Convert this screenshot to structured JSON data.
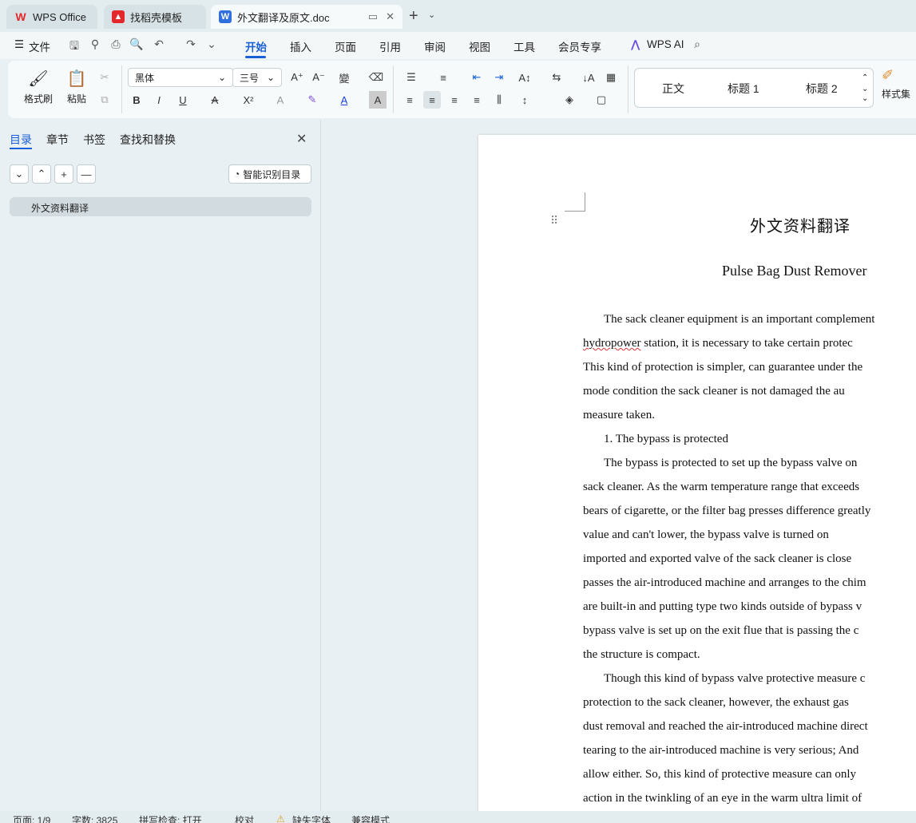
{
  "tabs": [
    {
      "label": "WPS Office",
      "icon": "wps-logo-icon"
    },
    {
      "label": "找稻壳模板",
      "icon": "docer-icon"
    },
    {
      "label": "外文翻译及原文.doc",
      "icon": "word-doc-icon"
    }
  ],
  "menu": {
    "file": "文件",
    "items": [
      "开始",
      "插入",
      "页面",
      "引用",
      "审阅",
      "视图",
      "工具",
      "会员专享"
    ],
    "ai": "WPS AI"
  },
  "ribbon": {
    "format_painter": "格式刷",
    "paste": "粘贴",
    "font_name": "黑体",
    "font_size": "三号",
    "styles": [
      "正文",
      "标题 1",
      "标题 2"
    ],
    "style_set": "样式集"
  },
  "nav_panel": {
    "tabs": [
      "目录",
      "章节",
      "书签",
      "查找和替换"
    ],
    "smart_toc": "智能识别目录",
    "toc_items": [
      "外文资料翻译"
    ]
  },
  "document": {
    "title": "外文资料翻译",
    "subtitle": "Pulse Bag Dust Remover",
    "lines": [
      {
        "text": "The sack cleaner equipment is an important complement",
        "indent": true
      },
      {
        "text": "hydropower station, it is necessary to take certain protec",
        "indent": false,
        "spell": "hydropower"
      },
      {
        "text": "This kind of protection is simpler, can guarantee under the",
        "indent": false
      },
      {
        "text": "mode condition the sack cleaner is not damaged the au",
        "indent": false
      },
      {
        "text": "measure taken.",
        "indent": false
      },
      {
        "text": "1. The bypass is protected",
        "indent": true
      },
      {
        "text": "The bypass is protected to set up the bypass valve on",
        "indent": true
      },
      {
        "text": "sack cleaner. As the warm temperature range that exceeds",
        "indent": false
      },
      {
        "text": "bears of cigarette, or the filter bag presses difference greatly",
        "indent": false
      },
      {
        "text": "value and can't lower, the bypass valve is turned on",
        "indent": false
      },
      {
        "text": "imported and exported valve of the sack cleaner is close",
        "indent": false
      },
      {
        "text": "passes the air-introduced machine and arranges to the chim",
        "indent": false
      },
      {
        "text": "are built-in and putting type two kinds outside of bypass v",
        "indent": false
      },
      {
        "text": "bypass valve is set up on the exit flue that is passing the c",
        "indent": false
      },
      {
        "text": "the structure is compact.",
        "indent": false
      },
      {
        "text": "Though this kind of bypass valve protective measure c",
        "indent": true
      },
      {
        "text": "protection to the sack cleaner, however, the exhaust gas",
        "indent": false
      },
      {
        "text": "dust removal and reached the air-introduced machine direct",
        "indent": false
      },
      {
        "text": "tearing to the air-introduced machine is very serious; And",
        "indent": false
      },
      {
        "text": "allow either. So, this kind of protective measure can only",
        "indent": false
      },
      {
        "text": "action in the twinkling of an eye in the warm ultra limit of",
        "indent": false
      }
    ]
  },
  "status": {
    "page": "页面: 1/9",
    "words": "字数: 3825",
    "spellcheck": "拼写检查: 打开",
    "proof": "校对",
    "missing_font": "缺失字体",
    "compat": "兼容模式"
  }
}
